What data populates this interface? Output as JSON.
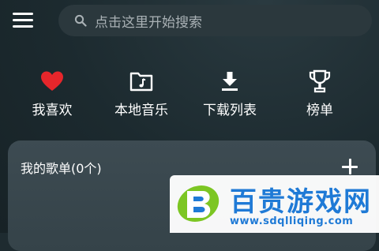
{
  "header": {
    "menu_icon": "hamburger-menu-icon",
    "search": {
      "placeholder": "点击这里开始搜索",
      "icon": "search-icon"
    }
  },
  "quick_actions": [
    {
      "label": "我喜欢",
      "icon": "heart-icon",
      "color": "#e6262b"
    },
    {
      "label": "本地音乐",
      "icon": "folder-music-icon",
      "color": "#ffffff"
    },
    {
      "label": "下载列表",
      "icon": "download-icon",
      "color": "#ffffff"
    },
    {
      "label": "榜单",
      "icon": "trophy-icon",
      "color": "#ffffff"
    }
  ],
  "playlist_card": {
    "title": "我的歌单(0个)",
    "add_icon": "plus-icon"
  },
  "watermark": {
    "name": "百贵游戏网",
    "url": "www.sdqlliqing.com"
  },
  "colors": {
    "background": "#1e2b30",
    "card": "#3a484f",
    "accent_red": "#e6262b",
    "watermark_blue": "#1f7ad6"
  }
}
